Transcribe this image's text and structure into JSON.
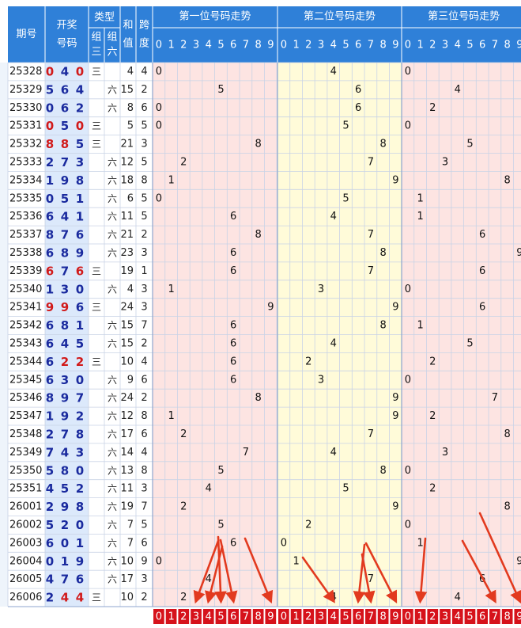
{
  "header": {
    "period": "期号",
    "draw_line1": "开奖",
    "draw_line2": "号码",
    "type": "类型",
    "group3_a": "组",
    "group3_b": "三",
    "group6_a": "组",
    "group6_b": "六",
    "sum_a": "和",
    "sum_b": "值",
    "span_a": "跨",
    "span_b": "度",
    "pos1": "第一位号码走势",
    "pos2": "第二位号码走势",
    "pos3": "第三位号码走势"
  },
  "digit_labels": [
    "0",
    "1",
    "2",
    "3",
    "4",
    "5",
    "6",
    "7",
    "8",
    "9"
  ],
  "colors": {
    "header_blue": "#2f80d8",
    "digit_blue": "#1a2a9e",
    "digit_red": "#d11a1a",
    "pos1_bg": "#fde4e2",
    "pos2_bg": "#fffbd9",
    "pos3_bg": "#fde4e2",
    "footer_red": "#d6121b",
    "arrow_red": "#e23a1f"
  },
  "chart_data": {
    "type": "table",
    "columns": [
      "期号",
      "开奖号码",
      "组三",
      "组六",
      "和值",
      "跨度",
      "第一位",
      "第二位",
      "第三位"
    ],
    "rows": [
      {
        "period": "25328",
        "digits": [
          0,
          4,
          0
        ],
        "type": "三",
        "sum": 4,
        "span": 4
      },
      {
        "period": "25329",
        "digits": [
          5,
          6,
          4
        ],
        "type": "六",
        "sum": 15,
        "span": 2
      },
      {
        "period": "25330",
        "digits": [
          0,
          6,
          2
        ],
        "type": "六",
        "sum": 8,
        "span": 6
      },
      {
        "period": "25331",
        "digits": [
          0,
          5,
          0
        ],
        "type": "三",
        "sum": 5,
        "span": 5
      },
      {
        "period": "25332",
        "digits": [
          8,
          8,
          5
        ],
        "type": "三",
        "sum": 21,
        "span": 3
      },
      {
        "period": "25333",
        "digits": [
          2,
          7,
          3
        ],
        "type": "六",
        "sum": 12,
        "span": 5
      },
      {
        "period": "25334",
        "digits": [
          1,
          9,
          8
        ],
        "type": "六",
        "sum": 18,
        "span": 8
      },
      {
        "period": "25335",
        "digits": [
          0,
          5,
          1
        ],
        "type": "六",
        "sum": 6,
        "span": 5
      },
      {
        "period": "25336",
        "digits": [
          6,
          4,
          1
        ],
        "type": "六",
        "sum": 11,
        "span": 5
      },
      {
        "period": "25337",
        "digits": [
          8,
          7,
          6
        ],
        "type": "六",
        "sum": 21,
        "span": 2
      },
      {
        "period": "25338",
        "digits": [
          6,
          8,
          9
        ],
        "type": "六",
        "sum": 23,
        "span": 3
      },
      {
        "period": "25339",
        "digits": [
          6,
          7,
          6
        ],
        "type": "三",
        "sum": 19,
        "span": 1
      },
      {
        "period": "25340",
        "digits": [
          1,
          3,
          0
        ],
        "type": "六",
        "sum": 4,
        "span": 3
      },
      {
        "period": "25341",
        "digits": [
          9,
          9,
          6
        ],
        "type": "三",
        "sum": 24,
        "span": 3
      },
      {
        "period": "25342",
        "digits": [
          6,
          8,
          1
        ],
        "type": "六",
        "sum": 15,
        "span": 7
      },
      {
        "period": "25343",
        "digits": [
          6,
          4,
          5
        ],
        "type": "六",
        "sum": 15,
        "span": 2
      },
      {
        "period": "25344",
        "digits": [
          6,
          2,
          2
        ],
        "type": "三",
        "sum": 10,
        "span": 4
      },
      {
        "period": "25345",
        "digits": [
          6,
          3,
          0
        ],
        "type": "六",
        "sum": 9,
        "span": 6
      },
      {
        "period": "25346",
        "digits": [
          8,
          9,
          7
        ],
        "type": "六",
        "sum": 24,
        "span": 2
      },
      {
        "period": "25347",
        "digits": [
          1,
          9,
          2
        ],
        "type": "六",
        "sum": 12,
        "span": 8
      },
      {
        "period": "25348",
        "digits": [
          2,
          7,
          8
        ],
        "type": "六",
        "sum": 17,
        "span": 6
      },
      {
        "period": "25349",
        "digits": [
          7,
          4,
          3
        ],
        "type": "六",
        "sum": 14,
        "span": 4
      },
      {
        "period": "25350",
        "digits": [
          5,
          8,
          0
        ],
        "type": "六",
        "sum": 13,
        "span": 8
      },
      {
        "period": "25351",
        "digits": [
          4,
          5,
          2
        ],
        "type": "六",
        "sum": 11,
        "span": 3
      },
      {
        "period": "26001",
        "digits": [
          2,
          9,
          8
        ],
        "type": "六",
        "sum": 19,
        "span": 7
      },
      {
        "period": "26002",
        "digits": [
          5,
          2,
          0
        ],
        "type": "六",
        "sum": 7,
        "span": 5
      },
      {
        "period": "26003",
        "digits": [
          6,
          0,
          1
        ],
        "type": "六",
        "sum": 7,
        "span": 6
      },
      {
        "period": "26004",
        "digits": [
          0,
          1,
          9
        ],
        "type": "六",
        "sum": 10,
        "span": 9
      },
      {
        "period": "26005",
        "digits": [
          4,
          7,
          6
        ],
        "type": "六",
        "sum": 17,
        "span": 3
      },
      {
        "period": "26006",
        "digits": [
          2,
          4,
          4
        ],
        "type": "三",
        "sum": 10,
        "span": 2
      }
    ],
    "annotations": {
      "arrows_target_digits": {
        "pos1": [
          3,
          4,
          5,
          6,
          9
        ],
        "pos2": [
          4,
          6,
          7,
          9
        ],
        "pos3": [
          1,
          7,
          9
        ]
      }
    }
  }
}
